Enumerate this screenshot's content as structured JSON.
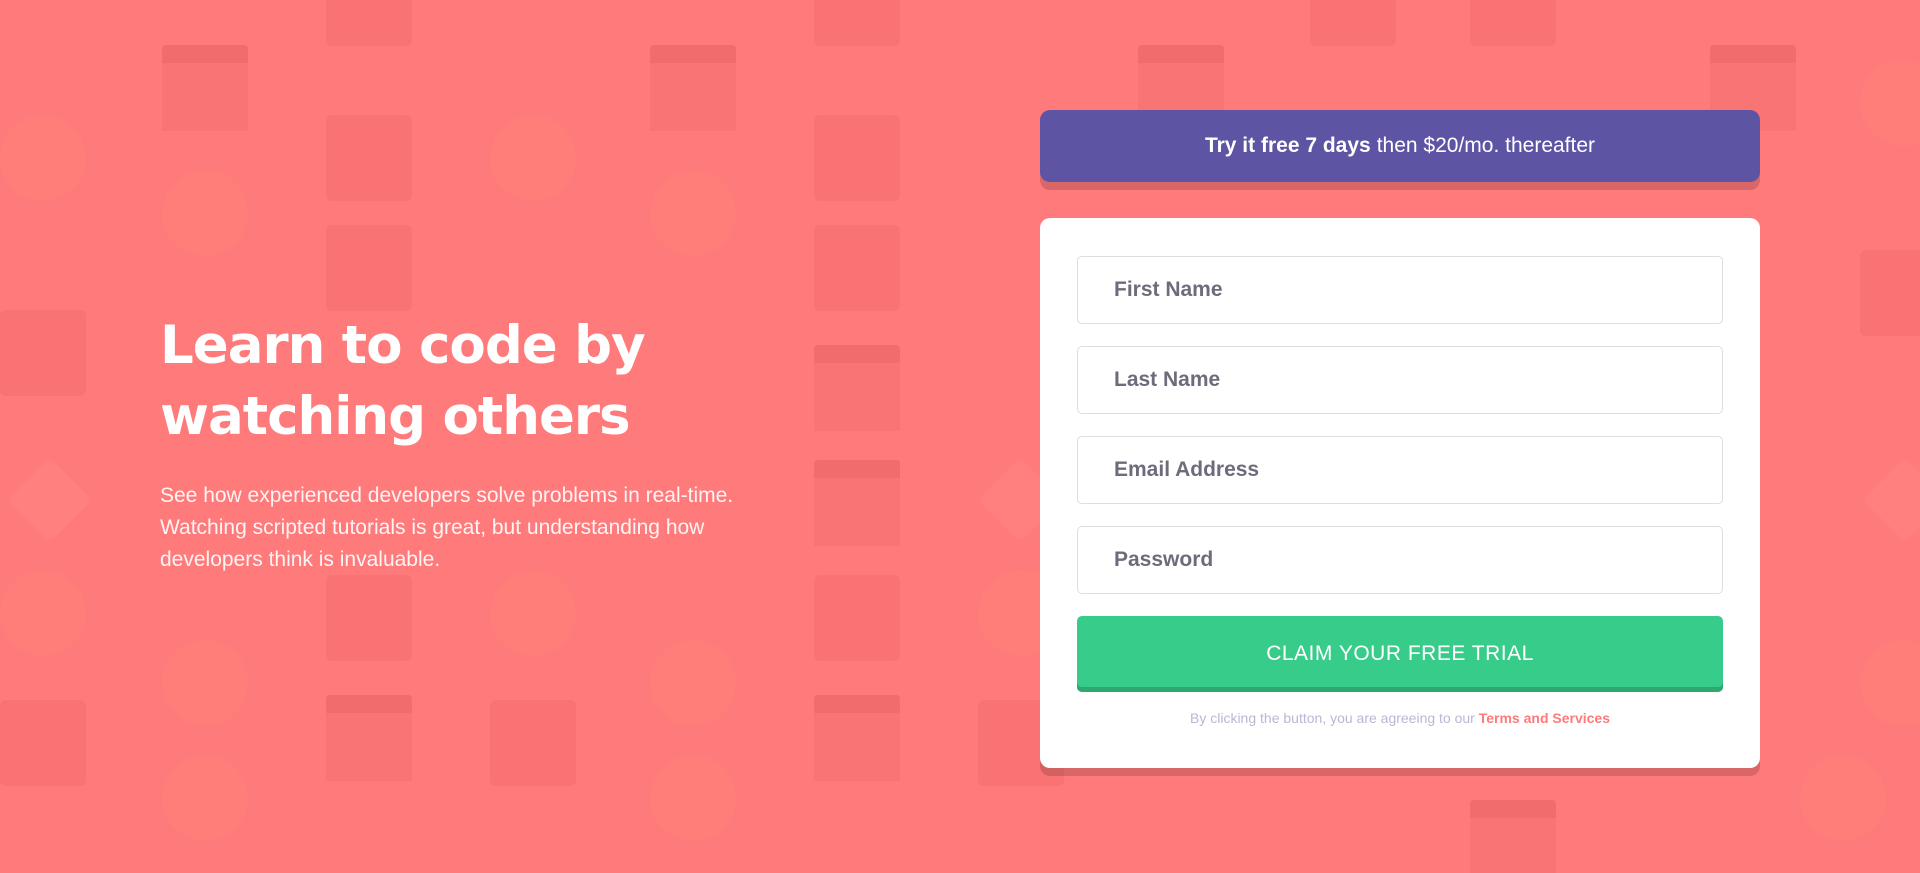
{
  "hero": {
    "title_line1": "Learn to code by",
    "title_line2": "watching others",
    "description": "See how experienced developers solve problems in real-time. Watching scripted tutorials is great, but understanding how developers think is invaluable."
  },
  "promo": {
    "bold_text": "Try it free 7 days",
    "text": "then $20/mo. thereafter"
  },
  "form": {
    "first_name_placeholder": "First Name",
    "last_name_placeholder": "Last Name",
    "email_placeholder": "Email Address",
    "password_placeholder": "Password",
    "submit_label": "CLAIM YOUR FREE TRIAL",
    "terms_prefix": "By clicking the button, you are agreeing to our",
    "terms_link": "Terms and Services"
  },
  "colors": {
    "background": "#ff7a7a",
    "promo": "#5e54a4",
    "cta": "#38cc8b",
    "terms_link": "#ff7a7a"
  },
  "icons": [
    "browser-window-icon",
    "chart-icon",
    "headset-icon",
    "gear-icon",
    "rocket-icon",
    "lifebuoy-icon",
    "lightbulb-icon",
    "calendar-icon",
    "globe-icon",
    "toolbox-icon"
  ]
}
